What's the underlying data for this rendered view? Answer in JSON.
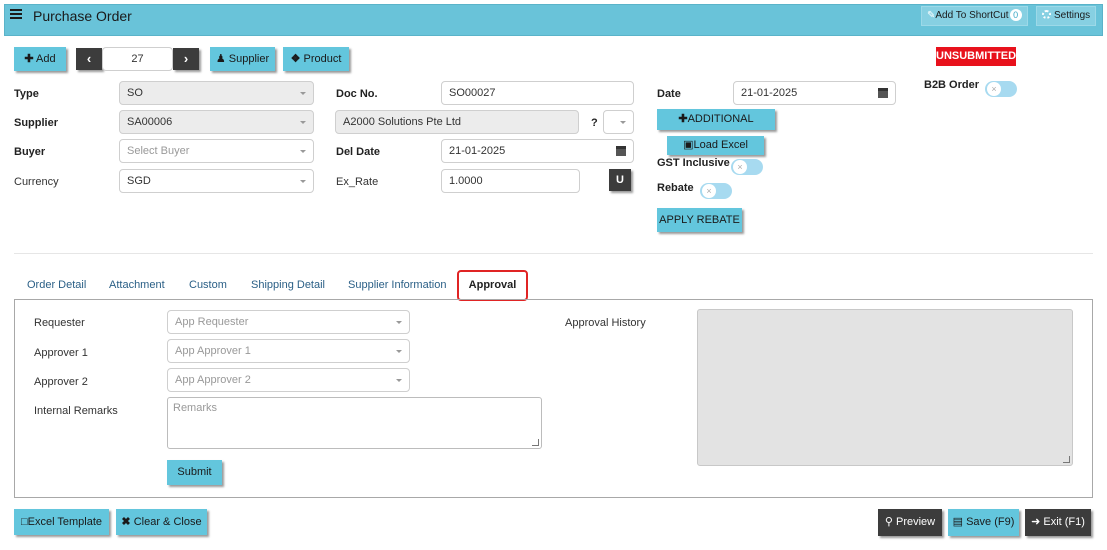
{
  "header": {
    "title": "Purchase Order",
    "shortcut_label": "Add To ShortCut",
    "shortcut_count": "0",
    "settings_label": "Settings"
  },
  "toolbar": {
    "add_label": "Add",
    "record_number": "27",
    "supplier_label": "Supplier",
    "product_label": "Product"
  },
  "status": {
    "label": "UNSUBMITTED",
    "color": "#e8111c"
  },
  "form": {
    "type": {
      "label": "Type",
      "value": "SO"
    },
    "supplier": {
      "label": "Supplier",
      "value": "SA00006"
    },
    "buyer": {
      "label": "Buyer",
      "placeholder": "Select Buyer"
    },
    "currency": {
      "label": "Currency",
      "value": "SGD"
    },
    "doc_no": {
      "label": "Doc No.",
      "value": "SO00027"
    },
    "supplier_name": {
      "value": "A2000 Solutions Pte Ltd"
    },
    "question_mark": "?",
    "del_date": {
      "label": "Del Date",
      "value": "21-01-2025"
    },
    "ex_rate": {
      "label": "Ex_Rate",
      "value": "1.0000"
    },
    "u_label": "U",
    "date": {
      "label": "Date",
      "value": "21-01-2025"
    },
    "additional_label": "ADDITIONAL",
    "load_excel_label": "Load Excel",
    "gst_inclusive_label": "GST Inclusive",
    "rebate_label": "Rebate",
    "apply_rebate_label": "APPLY REBATE",
    "b2b_order_label": "B2B Order"
  },
  "tabs": [
    {
      "label": "Order Detail"
    },
    {
      "label": "Attachment"
    },
    {
      "label": "Custom"
    },
    {
      "label": "Shipping Detail"
    },
    {
      "label": "Supplier Information"
    },
    {
      "label": "Approval",
      "active": true
    }
  ],
  "approval": {
    "requester_label": "Requester",
    "requester_placeholder": "App Requester",
    "approver1_label": "Approver 1",
    "approver1_placeholder": "App Approver 1",
    "approver2_label": "Approver 2",
    "approver2_placeholder": "App Approver 2",
    "internal_remarks_label": "Internal Remarks",
    "remarks_placeholder": "Remarks",
    "submit_label": "Submit",
    "history_label": "Approval History"
  },
  "footer": {
    "excel_template_label": "Excel Template",
    "clear_close_label": "Clear & Close",
    "preview_label": "Preview",
    "save_label": "Save (F9)",
    "exit_label": "Exit (F1)"
  },
  "colors": {
    "header": "#69c3d9",
    "button": "#63c6dd",
    "dark_button": "#3c3c3c",
    "active_tab_border": "#e02424"
  }
}
